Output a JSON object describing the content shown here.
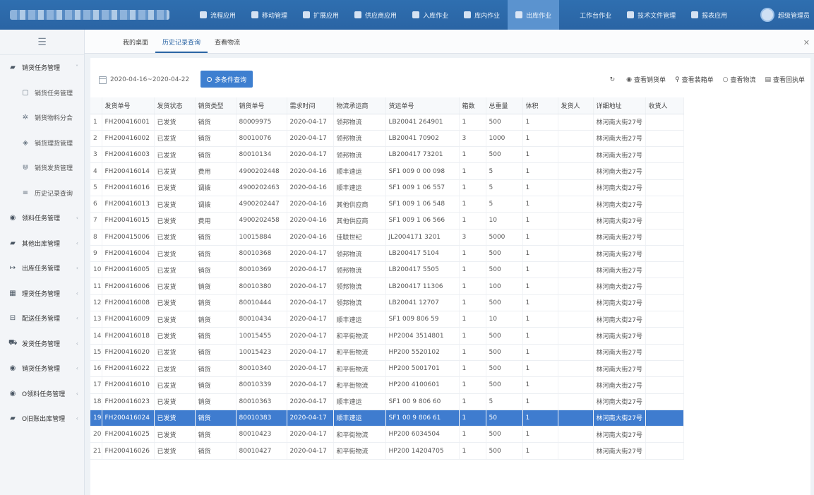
{
  "topbar": {
    "menu": [
      {
        "label": "流程应用",
        "icon": "share-icon",
        "active": false
      },
      {
        "label": "移动管理",
        "icon": "location-icon",
        "active": false
      },
      {
        "label": "扩展应用",
        "icon": "pin-icon",
        "active": false
      },
      {
        "label": "供应商应用",
        "icon": "user-circle-icon",
        "active": false
      },
      {
        "label": "入库作业",
        "icon": "list-icon",
        "active": false
      },
      {
        "label": "库内作业",
        "icon": "list-icon",
        "active": false
      },
      {
        "label": "出库作业",
        "icon": "list-icon",
        "active": true
      },
      {
        "label": "工作台作业",
        "icon": "",
        "active": false
      },
      {
        "label": "技术文件管理",
        "icon": "document-icon",
        "active": false
      },
      {
        "label": "报表应用",
        "icon": "chart-icon",
        "active": false
      }
    ],
    "user_label": "超级管理员"
  },
  "sidebar": {
    "items": [
      {
        "label": "销货任务管理",
        "icon": "truck-icon",
        "sub": false,
        "glyph": "▰",
        "chev": "˅"
      },
      {
        "label": "销货任务管理",
        "icon": "calendar-icon",
        "sub": true,
        "glyph": "▢",
        "chev": ""
      },
      {
        "label": "销货物料分合",
        "icon": "gear-icon",
        "sub": true,
        "glyph": "✲",
        "chev": ""
      },
      {
        "label": "销货理货管理",
        "icon": "box-icon",
        "sub": true,
        "glyph": "◈",
        "chev": ""
      },
      {
        "label": "销货发货管理",
        "icon": "magnet-icon",
        "sub": true,
        "glyph": "⋓",
        "chev": ""
      },
      {
        "label": "历史记录查询",
        "icon": "list-icon",
        "sub": true,
        "glyph": "≡",
        "chev": ""
      },
      {
        "label": "领料任务管理",
        "icon": "dot-circle-icon",
        "sub": false,
        "glyph": "◉",
        "chev": "‹"
      },
      {
        "label": "其他出库管理",
        "icon": "truck-icon",
        "sub": false,
        "glyph": "▰",
        "chev": "‹"
      },
      {
        "label": "出库任务管理",
        "icon": "export-icon",
        "sub": false,
        "glyph": "↦",
        "chev": "‹"
      },
      {
        "label": "理货任务管理",
        "icon": "grid-icon",
        "sub": false,
        "glyph": "▦",
        "chev": "‹"
      },
      {
        "label": "配送任务管理",
        "icon": "cart-icon",
        "sub": false,
        "glyph": "⊟",
        "chev": "‹"
      },
      {
        "label": "发货任务管理",
        "icon": "bus-icon",
        "sub": false,
        "glyph": "⛟",
        "chev": "‹"
      },
      {
        "label": "销货任务管理",
        "icon": "dot-circle-icon",
        "sub": false,
        "glyph": "◉",
        "chev": "‹"
      },
      {
        "label": "O领料任务管理",
        "icon": "dot-circle-icon",
        "sub": false,
        "glyph": "◉",
        "chev": "‹"
      },
      {
        "label": "O旧账出库管理",
        "icon": "truck-icon",
        "sub": false,
        "glyph": "▰",
        "chev": "‹"
      }
    ]
  },
  "tabs": [
    {
      "label": "我的桌面",
      "active": false
    },
    {
      "label": "历史记录查询",
      "active": true
    },
    {
      "label": "查看物流",
      "active": false
    }
  ],
  "toolbar": {
    "date_range": "2020-04-16~2020-04-22",
    "query_button": "多条件查询",
    "actions": [
      {
        "label": "",
        "icon": "refresh-icon",
        "glyph": "↻"
      },
      {
        "label": "查看销货单",
        "icon": "radio-icon",
        "glyph": "◉"
      },
      {
        "label": "查看装箱单",
        "icon": "share-icon",
        "glyph": "⚲"
      },
      {
        "label": "查看物流",
        "icon": "radio-empty-icon",
        "glyph": "○"
      },
      {
        "label": "查看回执单",
        "icon": "document-icon",
        "glyph": "▤"
      }
    ]
  },
  "table": {
    "columns": [
      "",
      "发货单号",
      "发货状态",
      "销货类型",
      "销货单号",
      "需求时间",
      "物流承运商",
      "货运单号",
      "箱数",
      "总重量",
      "体积",
      "发货人",
      "详细地址",
      "收货人"
    ],
    "rows": [
      [
        "1",
        "FH200416001",
        "已发货",
        "销货",
        "80009975",
        "2020-04-17",
        "领邦物流",
        "LB20041   264901",
        "1",
        "500",
        "1",
        "",
        "林河南大街27号",
        ""
      ],
      [
        "2",
        "FH200416002",
        "已发货",
        "销货",
        "80010076",
        "2020-04-17",
        "领邦物流",
        "LB20041   70902",
        "3",
        "1000",
        "1",
        "",
        "林河南大街27号",
        ""
      ],
      [
        "3",
        "FH200416003",
        "已发货",
        "销货",
        "80010134",
        "2020-04-17",
        "领邦物流",
        "LB200417   73201",
        "1",
        "500",
        "1",
        "",
        "林河南大街27号",
        ""
      ],
      [
        "4",
        "FH200416014",
        "已发货",
        "费用",
        "4900202448",
        "2020-04-16",
        "顺丰速运",
        "SF1 009 0   00 098",
        "1",
        "5",
        "1",
        "",
        "林河南大街27号",
        ""
      ],
      [
        "5",
        "FH200416016",
        "已发货",
        "调拨",
        "4900202463",
        "2020-04-16",
        "顺丰速运",
        "SF1 009 1   06 557",
        "1",
        "5",
        "1",
        "",
        "林河南大街27号",
        ""
      ],
      [
        "6",
        "FH200416013",
        "已发货",
        "调拨",
        "4900202447",
        "2020-04-16",
        "其他供应商",
        "SF1 009 1   06 548",
        "1",
        "5",
        "1",
        "",
        "林河南大街27号",
        ""
      ],
      [
        "7",
        "FH200416015",
        "已发货",
        "费用",
        "4900202458",
        "2020-04-16",
        "其他供应商",
        "SF1 009 1   06 566",
        "1",
        "10",
        "1",
        "",
        "林河南大街27号",
        ""
      ],
      [
        "8",
        "FH200415006",
        "已发货",
        "销货",
        "10015884",
        "2020-04-16",
        "佳联世纪",
        "JL2004171   3201",
        "3",
        "5000",
        "1",
        "",
        "林河南大街27号",
        ""
      ],
      [
        "9",
        "FH200416004",
        "已发货",
        "销货",
        "80010368",
        "2020-04-17",
        "领邦物流",
        "LB200417   5104",
        "1",
        "500",
        "1",
        "",
        "林河南大街27号",
        ""
      ],
      [
        "10",
        "FH200416005",
        "已发货",
        "销货",
        "80010369",
        "2020-04-17",
        "领邦物流",
        "LB200417   5505",
        "1",
        "500",
        "1",
        "",
        "林河南大街27号",
        ""
      ],
      [
        "11",
        "FH200416006",
        "已发货",
        "销货",
        "80010380",
        "2020-04-17",
        "领邦物流",
        "LB200417   11306",
        "1",
        "100",
        "1",
        "",
        "林河南大街27号",
        ""
      ],
      [
        "12",
        "FH200416008",
        "已发货",
        "销货",
        "80010444",
        "2020-04-17",
        "领邦物流",
        "LB20041   12707",
        "1",
        "500",
        "1",
        "",
        "林河南大街27号",
        ""
      ],
      [
        "13",
        "FH200416009",
        "已发货",
        "销货",
        "80010434",
        "2020-04-17",
        "顺丰速运",
        "SF1 009   806 59",
        "1",
        "10",
        "1",
        "",
        "林河南大街27号",
        ""
      ],
      [
        "14",
        "FH200416018",
        "已发货",
        "销货",
        "10015455",
        "2020-04-17",
        "和平街物流",
        "HP2004   3514801",
        "1",
        "500",
        "1",
        "",
        "林河南大街27号",
        ""
      ],
      [
        "15",
        "FH200416020",
        "已发货",
        "销货",
        "10015423",
        "2020-04-17",
        "和平街物流",
        "HP200   5520102",
        "1",
        "500",
        "1",
        "",
        "林河南大街27号",
        ""
      ],
      [
        "16",
        "FH200416022",
        "已发货",
        "销货",
        "80010340",
        "2020-04-17",
        "和平街物流",
        "HP200   5001701",
        "1",
        "500",
        "1",
        "",
        "林河南大街27号",
        ""
      ],
      [
        "17",
        "FH200416010",
        "已发货",
        "销货",
        "80010339",
        "2020-04-17",
        "和平街物流",
        "HP200   4100601",
        "1",
        "500",
        "1",
        "",
        "林河南大街27号",
        ""
      ],
      [
        "18",
        "FH200416023",
        "已发货",
        "销货",
        "80010363",
        "2020-04-17",
        "顺丰速运",
        "SF1 00   9 806 60",
        "1",
        "5",
        "1",
        "",
        "林河南大街27号",
        ""
      ],
      [
        "19",
        "FH200416024",
        "已发货",
        "销货",
        "80010383",
        "2020-04-17",
        "顺丰速运",
        "SF1 00   9 806 61",
        "1",
        "50",
        "1",
        "",
        "林河南大街27号",
        ""
      ],
      [
        "20",
        "FH200416025",
        "已发货",
        "销货",
        "80010423",
        "2020-04-17",
        "和平街物流",
        "HP200   6034504",
        "1",
        "500",
        "1",
        "",
        "林河南大街27号",
        ""
      ],
      [
        "21",
        "FH200416026",
        "已发货",
        "销货",
        "80010427",
        "2020-04-17",
        "和平街物流",
        "HP200   14204705",
        "1",
        "500",
        "1",
        "",
        "林河南大街27号",
        ""
      ]
    ],
    "selected_row": 19
  },
  "colors": {
    "accent": "#2a64a4",
    "selected_row": "#3f7ccf",
    "query_button": "#3e7fd0"
  }
}
